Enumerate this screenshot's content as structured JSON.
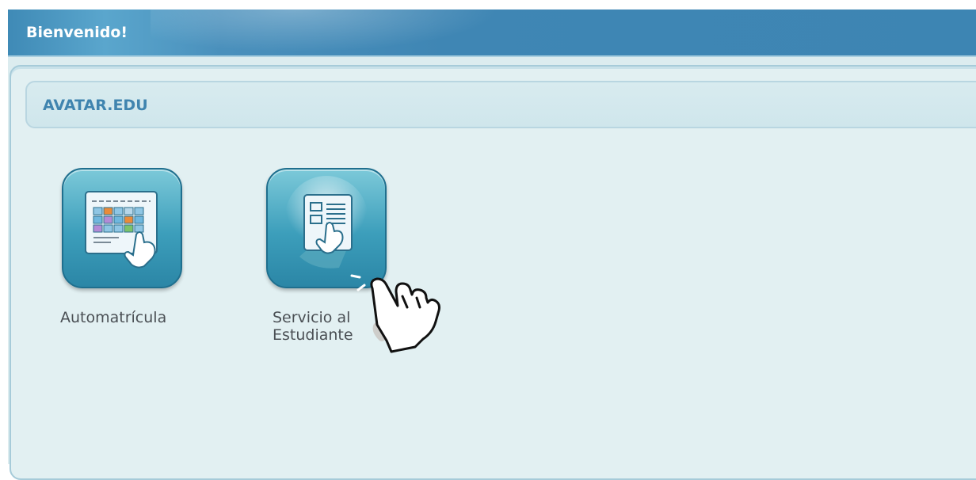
{
  "window": {
    "title": "Bienvenido!"
  },
  "panel": {
    "header": "AVATAR.EDU"
  },
  "apps": [
    {
      "label": "Automatrícula",
      "icon": "calendar-touch-icon"
    },
    {
      "label_line1": "Servicio al",
      "label_line2": "Estudiante",
      "icon": "document-touch-icon"
    }
  ],
  "cursor": {
    "icon": "pointing-hand-icon"
  },
  "colors": {
    "titlebar": "#3f86b4",
    "panel_bg": "#e2f0f2",
    "header_text": "#3f84af",
    "icon_tile": "#3c9ebb"
  }
}
